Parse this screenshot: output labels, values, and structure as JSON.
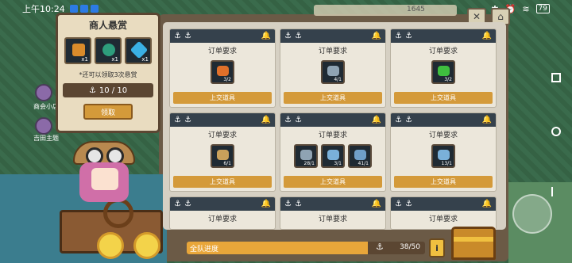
{
  "status_bar": {
    "time": "上午10:24",
    "battery": "79"
  },
  "hud": {
    "value": "1645"
  },
  "bounty": {
    "title": "商人悬赏",
    "items": [
      {
        "icon": "chest-icon",
        "count": "x1",
        "color": "#d98b2b"
      },
      {
        "icon": "swirl-icon",
        "count": "x1",
        "color": "#2e9d7c"
      },
      {
        "icon": "gem-icon",
        "count": "x1",
        "color": "#3ab0e5"
      }
    ],
    "note": "*还可以领取3次悬赏",
    "progress": "10 / 10",
    "claim_label": "领取"
  },
  "orders": {
    "title": "订单要求",
    "submit_label": "上交道具",
    "cards": [
      {
        "items": [
          {
            "icon": "carrot-icon",
            "count": "3/2",
            "color": "#e0702a"
          }
        ]
      },
      {
        "items": [
          {
            "icon": "fish-icon",
            "count": "4/1",
            "color": "#8fa3b3"
          }
        ]
      },
      {
        "items": [
          {
            "icon": "clover-icon",
            "count": "3/2",
            "color": "#3fbf3f"
          }
        ]
      },
      {
        "items": [
          {
            "icon": "fish-icon",
            "count": "6/1",
            "color": "#c9a15b"
          }
        ]
      },
      {
        "items": [
          {
            "icon": "fish-icon",
            "count": "28/1",
            "color": "#8fa3b3"
          },
          {
            "icon": "fish-icon",
            "count": "3/1",
            "color": "#7ab0d9"
          },
          {
            "icon": "fish-icon",
            "count": "41/1",
            "color": "#6f9fc9"
          }
        ]
      },
      {
        "items": [
          {
            "icon": "fish-icon",
            "count": "13/1",
            "color": "#7ab0d9"
          }
        ]
      },
      {
        "items": []
      },
      {
        "items": []
      },
      {
        "items": []
      }
    ]
  },
  "team_progress": {
    "label": "全队进度",
    "value": "38/50",
    "fraction": 0.76
  },
  "info_button": "i",
  "side_labels": [
    "商会小店",
    "吉田主题"
  ]
}
